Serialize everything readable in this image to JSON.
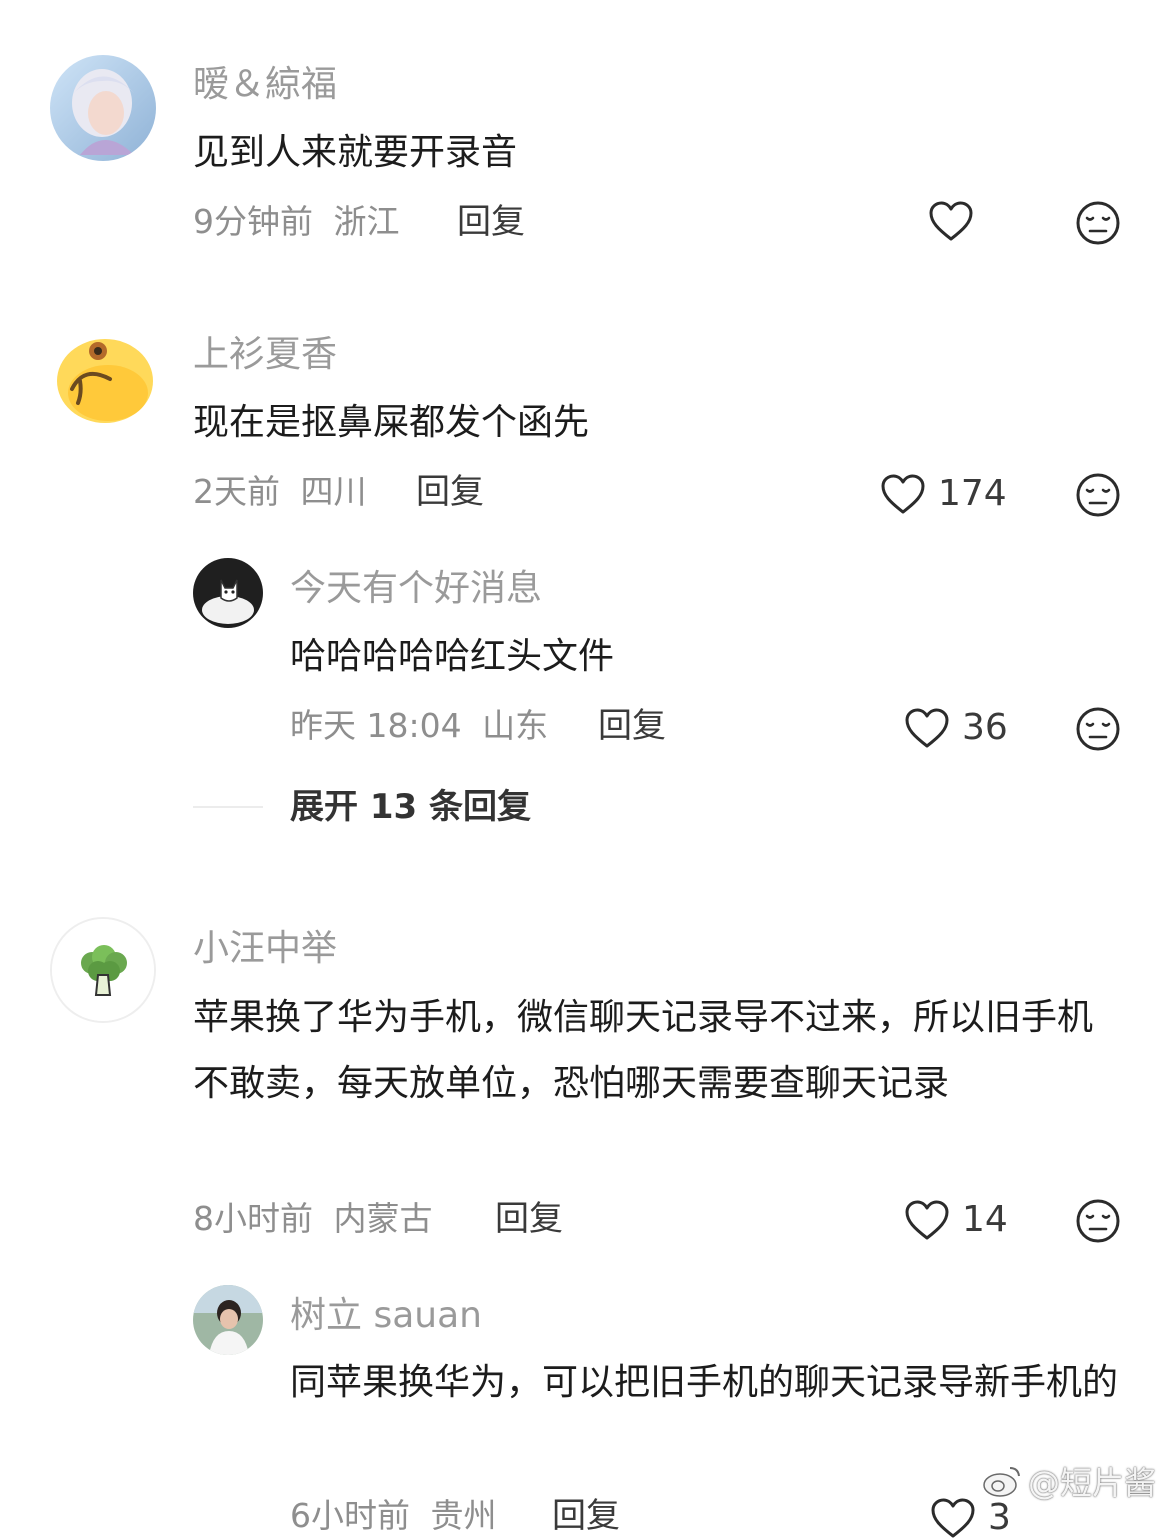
{
  "comments": [
    {
      "username": "暧＆綡福",
      "text": "见到人来就要开录音",
      "time": "9分钟前",
      "location": "浙江",
      "reply_label": "回复",
      "likes": null
    },
    {
      "username": "上衫夏香",
      "text": "现在是抠鼻屎都发个函先",
      "time": "2天前",
      "location": "四川",
      "reply_label": "回复",
      "likes": "174",
      "sub_reply": {
        "username": "今天有个好消息",
        "text": "哈哈哈哈哈红头文件",
        "time": "昨天 18:04",
        "location": "山东",
        "reply_label": "回复",
        "likes": "36"
      },
      "expand_label": "展开 13 条回复"
    },
    {
      "username": "小汪中举",
      "text": "苹果换了华为手机，微信聊天记录导不过来，所以旧手机不敢卖，每天放单位，恐怕哪天需要查聊天记录",
      "time": "8小时前",
      "location": "内蒙古",
      "reply_label": "回复",
      "likes": "14",
      "sub_reply": {
        "username": "树立 sauan",
        "text": "同苹果换华为，可以把旧手机的聊天记录导新手机的",
        "time": "6小时前",
        "location": "贵州",
        "reply_label": "回复",
        "likes": "3"
      }
    }
  ],
  "watermark": "@短片酱",
  "icons": {
    "like": "heart-outline-icon",
    "dislike": "neutral-face-icon"
  },
  "colors": {
    "username": "#9a9a9a",
    "text": "#1c1c1c",
    "meta": "#8e8e8e",
    "icon": "#2b2b2b"
  }
}
